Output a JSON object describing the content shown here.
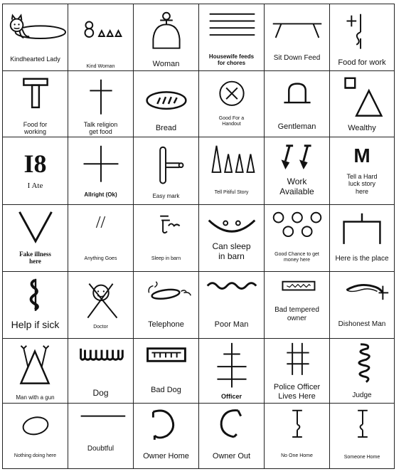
{
  "rows": [
    [
      {
        "label": "Kindhearted Lady",
        "icon": "cat-lying-on-bed-icon"
      },
      {
        "label": "Kind Woman",
        "icon": "circles-and-triangles-icon"
      },
      {
        "label": "Woman",
        "icon": "bell-figure-icon"
      },
      {
        "label": "Housewife feeds\nfor chores",
        "icon": "horizontal-lines-icon"
      },
      {
        "label": "Sit Down Feed",
        "icon": "table-icon"
      },
      {
        "label": "Food for work",
        "icon": "plus-and-squiggle-icon"
      }
    ],
    [
      {
        "label": "Food for\nworking",
        "icon": "t-pillar-icon"
      },
      {
        "label": "Talk religion\nget food",
        "icon": "cross-icon"
      },
      {
        "label": "Bread",
        "icon": "bread-loaf-icon"
      },
      {
        "label": "Good For a\nHandout",
        "icon": "circled-x-icon"
      },
      {
        "label": "Gentleman",
        "icon": "top-hat-icon"
      },
      {
        "label": "Wealthy",
        "icon": "house-and-triangle-icon"
      }
    ],
    [
      {
        "label": "I Ate",
        "icon": "i8-glyph-icon",
        "glyph": "I8"
      },
      {
        "label": "Allright  (Ok)",
        "icon": "plus-cross-icon"
      },
      {
        "label": "Easy mark",
        "icon": "barbell-key-icon"
      },
      {
        "label": "Tell Pitiful Story",
        "icon": "four-spikes-icon"
      },
      {
        "label": "Work\nAvailable",
        "icon": "two-shovels-icon"
      },
      {
        "label": "Tell a Hard\nluck story\nhere",
        "icon": "m-glyph-icon",
        "glyph": "M"
      }
    ],
    [
      {
        "label": "Fake illness\nhere",
        "icon": "v-shape-icon"
      },
      {
        "label": "Anything Goes",
        "icon": "double-slash-icon",
        "glyph": "//"
      },
      {
        "label": "Sleep in barn",
        "icon": "hook-scribble-icon"
      },
      {
        "label": "Can sleep\nin barn",
        "icon": "smiley-arc-icon"
      },
      {
        "label": "Good Chance to get\nmoney here",
        "icon": "five-circles-icon"
      },
      {
        "label": "Here is the place",
        "icon": "t-bracket-icon"
      }
    ],
    [
      {
        "label": "Help if sick",
        "icon": "staff-of-aesculapius-icon"
      },
      {
        "label": "Doctor",
        "icon": "stick-figure-doctor-icon"
      },
      {
        "label": "Telephone",
        "icon": "telephone-loop-icon"
      },
      {
        "label": "Poor Man",
        "icon": "wavy-line-icon"
      },
      {
        "label": "Bad tempered\nowner",
        "icon": "box-with-zigzag-icon"
      },
      {
        "label": "Dishonest Man",
        "icon": "arc-arrow-icon"
      }
    ],
    [
      {
        "label": "Man with a gun",
        "icon": "triangle-arms-icon"
      },
      {
        "label": "Dog",
        "icon": "dog-teeth-icon"
      },
      {
        "label": "Bad Dog",
        "icon": "framed-teeth-icon"
      },
      {
        "label": "Officer",
        "icon": "double-cross-icon"
      },
      {
        "label": "Police Officer\nLives Here",
        "icon": "hash-grid-icon"
      },
      {
        "label": "Judge",
        "icon": "spring-coil-icon"
      }
    ],
    [
      {
        "label": "Nothing doing here",
        "icon": "oval-icon"
      },
      {
        "label": "Doubtful",
        "icon": "horizontal-line-icon"
      },
      {
        "label": "Owner Home",
        "icon": "open-circle-icon"
      },
      {
        "label": "Owner Out",
        "icon": "c-arc-icon"
      },
      {
        "label": "No One Home",
        "icon": "i-beam-bump-right-icon"
      },
      {
        "label": "Someone Home",
        "icon": "i-beam-bump-left-icon"
      }
    ]
  ]
}
